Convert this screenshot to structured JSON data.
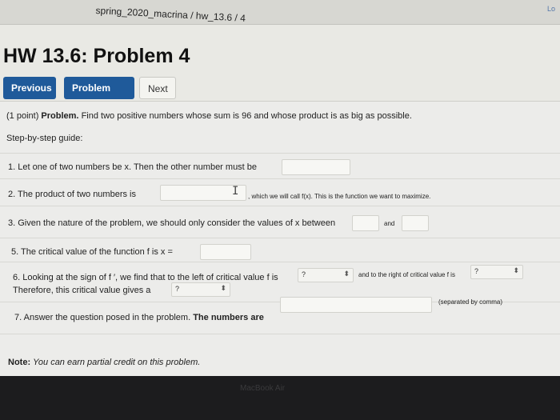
{
  "breadcrumb": "spring_2020_macrina / hw_13.6 / 4",
  "corner_link": "Lo",
  "page_title": "HW 13.6: Problem 4",
  "nav": {
    "previous": "Previous",
    "problem_list": "Problem List",
    "next": "Next"
  },
  "problem": {
    "points": "(1 point)",
    "heading": "Problem.",
    "statement": "Find two positive numbers whose sum is 96 and whose product is as big as possible.",
    "guide": "Step-by-step guide:",
    "step1": "1. Let one of two numbers be x. Then the other number must be",
    "step2": "2. The product of two numbers is",
    "step2_tail": ", which we will call f(x). This is the function we want to maximize.",
    "step3": "3. Given the nature of the problem, we should only consider the values of x between",
    "step3_and": "and",
    "step5": "5. The critical value of the function f is x =",
    "step6_a": "6. Looking at the sign of f ′, we find that to the left of critical value f is",
    "step6_b": "and to the right of critical value f is",
    "step6_c": "Therefore, this critical value gives a",
    "step6_left_value": "?",
    "step6_right_value": "?",
    "step6_gives_value": "?",
    "separated_hint": "(separated by comma)",
    "step7": "7. Answer the question posed in the problem.",
    "step7_bold": "The numbers are",
    "note_label": "Note:",
    "note_text": "You can earn partial credit on this problem."
  },
  "bezel_label": "MacBook Air"
}
